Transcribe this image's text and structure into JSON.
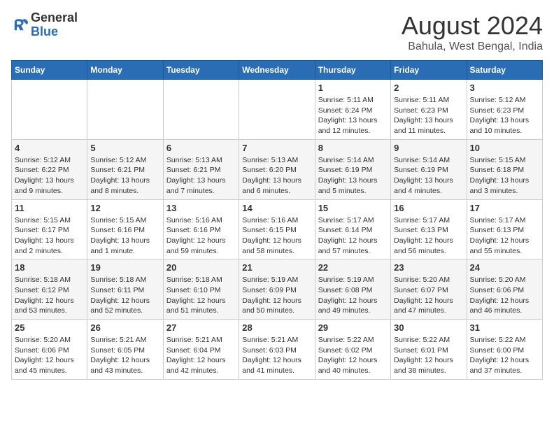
{
  "header": {
    "logo_line1": "General",
    "logo_line2": "Blue",
    "month_title": "August 2024",
    "subtitle": "Bahula, West Bengal, India"
  },
  "days_of_week": [
    "Sunday",
    "Monday",
    "Tuesday",
    "Wednesday",
    "Thursday",
    "Friday",
    "Saturday"
  ],
  "weeks": [
    [
      {
        "day": "",
        "info": ""
      },
      {
        "day": "",
        "info": ""
      },
      {
        "day": "",
        "info": ""
      },
      {
        "day": "",
        "info": ""
      },
      {
        "day": "1",
        "info": "Sunrise: 5:11 AM\nSunset: 6:24 PM\nDaylight: 13 hours\nand 12 minutes."
      },
      {
        "day": "2",
        "info": "Sunrise: 5:11 AM\nSunset: 6:23 PM\nDaylight: 13 hours\nand 11 minutes."
      },
      {
        "day": "3",
        "info": "Sunrise: 5:12 AM\nSunset: 6:23 PM\nDaylight: 13 hours\nand 10 minutes."
      }
    ],
    [
      {
        "day": "4",
        "info": "Sunrise: 5:12 AM\nSunset: 6:22 PM\nDaylight: 13 hours\nand 9 minutes."
      },
      {
        "day": "5",
        "info": "Sunrise: 5:12 AM\nSunset: 6:21 PM\nDaylight: 13 hours\nand 8 minutes."
      },
      {
        "day": "6",
        "info": "Sunrise: 5:13 AM\nSunset: 6:21 PM\nDaylight: 13 hours\nand 7 minutes."
      },
      {
        "day": "7",
        "info": "Sunrise: 5:13 AM\nSunset: 6:20 PM\nDaylight: 13 hours\nand 6 minutes."
      },
      {
        "day": "8",
        "info": "Sunrise: 5:14 AM\nSunset: 6:19 PM\nDaylight: 13 hours\nand 5 minutes."
      },
      {
        "day": "9",
        "info": "Sunrise: 5:14 AM\nSunset: 6:19 PM\nDaylight: 13 hours\nand 4 minutes."
      },
      {
        "day": "10",
        "info": "Sunrise: 5:15 AM\nSunset: 6:18 PM\nDaylight: 13 hours\nand 3 minutes."
      }
    ],
    [
      {
        "day": "11",
        "info": "Sunrise: 5:15 AM\nSunset: 6:17 PM\nDaylight: 13 hours\nand 2 minutes."
      },
      {
        "day": "12",
        "info": "Sunrise: 5:15 AM\nSunset: 6:16 PM\nDaylight: 13 hours\nand 1 minute."
      },
      {
        "day": "13",
        "info": "Sunrise: 5:16 AM\nSunset: 6:16 PM\nDaylight: 12 hours\nand 59 minutes."
      },
      {
        "day": "14",
        "info": "Sunrise: 5:16 AM\nSunset: 6:15 PM\nDaylight: 12 hours\nand 58 minutes."
      },
      {
        "day": "15",
        "info": "Sunrise: 5:17 AM\nSunset: 6:14 PM\nDaylight: 12 hours\nand 57 minutes."
      },
      {
        "day": "16",
        "info": "Sunrise: 5:17 AM\nSunset: 6:13 PM\nDaylight: 12 hours\nand 56 minutes."
      },
      {
        "day": "17",
        "info": "Sunrise: 5:17 AM\nSunset: 6:13 PM\nDaylight: 12 hours\nand 55 minutes."
      }
    ],
    [
      {
        "day": "18",
        "info": "Sunrise: 5:18 AM\nSunset: 6:12 PM\nDaylight: 12 hours\nand 53 minutes."
      },
      {
        "day": "19",
        "info": "Sunrise: 5:18 AM\nSunset: 6:11 PM\nDaylight: 12 hours\nand 52 minutes."
      },
      {
        "day": "20",
        "info": "Sunrise: 5:18 AM\nSunset: 6:10 PM\nDaylight: 12 hours\nand 51 minutes."
      },
      {
        "day": "21",
        "info": "Sunrise: 5:19 AM\nSunset: 6:09 PM\nDaylight: 12 hours\nand 50 minutes."
      },
      {
        "day": "22",
        "info": "Sunrise: 5:19 AM\nSunset: 6:08 PM\nDaylight: 12 hours\nand 49 minutes."
      },
      {
        "day": "23",
        "info": "Sunrise: 5:20 AM\nSunset: 6:07 PM\nDaylight: 12 hours\nand 47 minutes."
      },
      {
        "day": "24",
        "info": "Sunrise: 5:20 AM\nSunset: 6:06 PM\nDaylight: 12 hours\nand 46 minutes."
      }
    ],
    [
      {
        "day": "25",
        "info": "Sunrise: 5:20 AM\nSunset: 6:06 PM\nDaylight: 12 hours\nand 45 minutes."
      },
      {
        "day": "26",
        "info": "Sunrise: 5:21 AM\nSunset: 6:05 PM\nDaylight: 12 hours\nand 43 minutes."
      },
      {
        "day": "27",
        "info": "Sunrise: 5:21 AM\nSunset: 6:04 PM\nDaylight: 12 hours\nand 42 minutes."
      },
      {
        "day": "28",
        "info": "Sunrise: 5:21 AM\nSunset: 6:03 PM\nDaylight: 12 hours\nand 41 minutes."
      },
      {
        "day": "29",
        "info": "Sunrise: 5:22 AM\nSunset: 6:02 PM\nDaylight: 12 hours\nand 40 minutes."
      },
      {
        "day": "30",
        "info": "Sunrise: 5:22 AM\nSunset: 6:01 PM\nDaylight: 12 hours\nand 38 minutes."
      },
      {
        "day": "31",
        "info": "Sunrise: 5:22 AM\nSunset: 6:00 PM\nDaylight: 12 hours\nand 37 minutes."
      }
    ]
  ]
}
